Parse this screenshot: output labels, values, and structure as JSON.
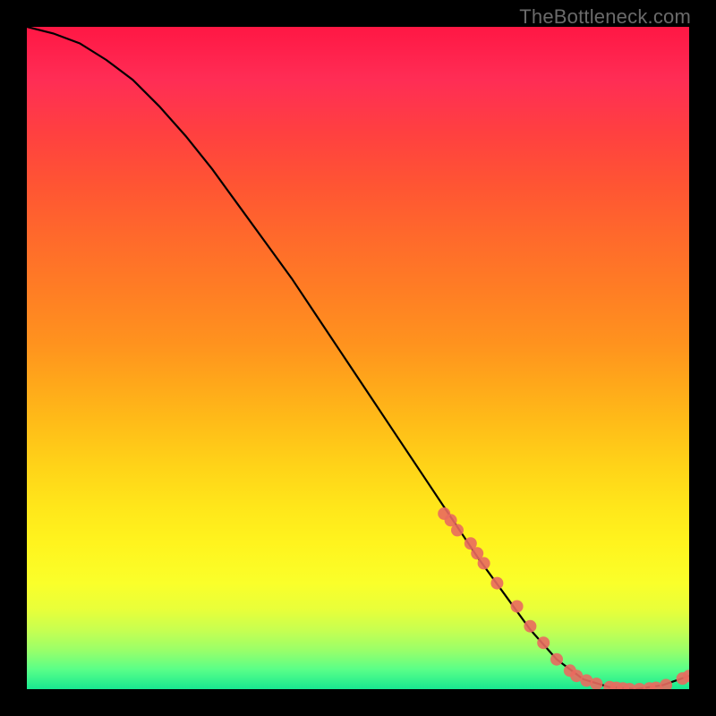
{
  "watermark": "TheBottleneck.com",
  "chart_data": {
    "type": "line",
    "title": "",
    "xlabel": "",
    "ylabel": "",
    "xlim": [
      0,
      100
    ],
    "ylim": [
      0,
      100
    ],
    "grid": false,
    "series": [
      {
        "name": "curve",
        "x": [
          0,
          4,
          8,
          12,
          16,
          20,
          24,
          28,
          32,
          36,
          40,
          44,
          48,
          52,
          56,
          60,
          64,
          68,
          72,
          76,
          80,
          84,
          88,
          92,
          96,
          100
        ],
        "values": [
          100,
          99,
          97.5,
          95,
          92,
          88,
          83.5,
          78.5,
          73,
          67.5,
          62,
          56,
          50,
          44,
          38,
          32,
          26,
          20,
          14.5,
          9,
          4.5,
          1.5,
          0.3,
          0,
          0.6,
          2
        ],
        "markers_x": [
          63,
          64,
          65,
          67,
          68,
          69,
          71,
          74,
          76,
          78,
          80,
          82,
          83,
          84.5,
          86,
          88,
          89,
          90,
          91,
          92.5,
          94,
          95,
          96.5,
          99,
          100
        ],
        "markers_values": [
          26.5,
          25.5,
          24,
          22,
          20.5,
          19,
          16,
          12.5,
          9.5,
          7,
          4.5,
          2.8,
          2,
          1.3,
          0.8,
          0.3,
          0.2,
          0.1,
          0,
          0,
          0.1,
          0.2,
          0.6,
          1.6,
          2
        ]
      }
    ],
    "marker_color": "#e96a5f",
    "line_color": "#000000"
  }
}
